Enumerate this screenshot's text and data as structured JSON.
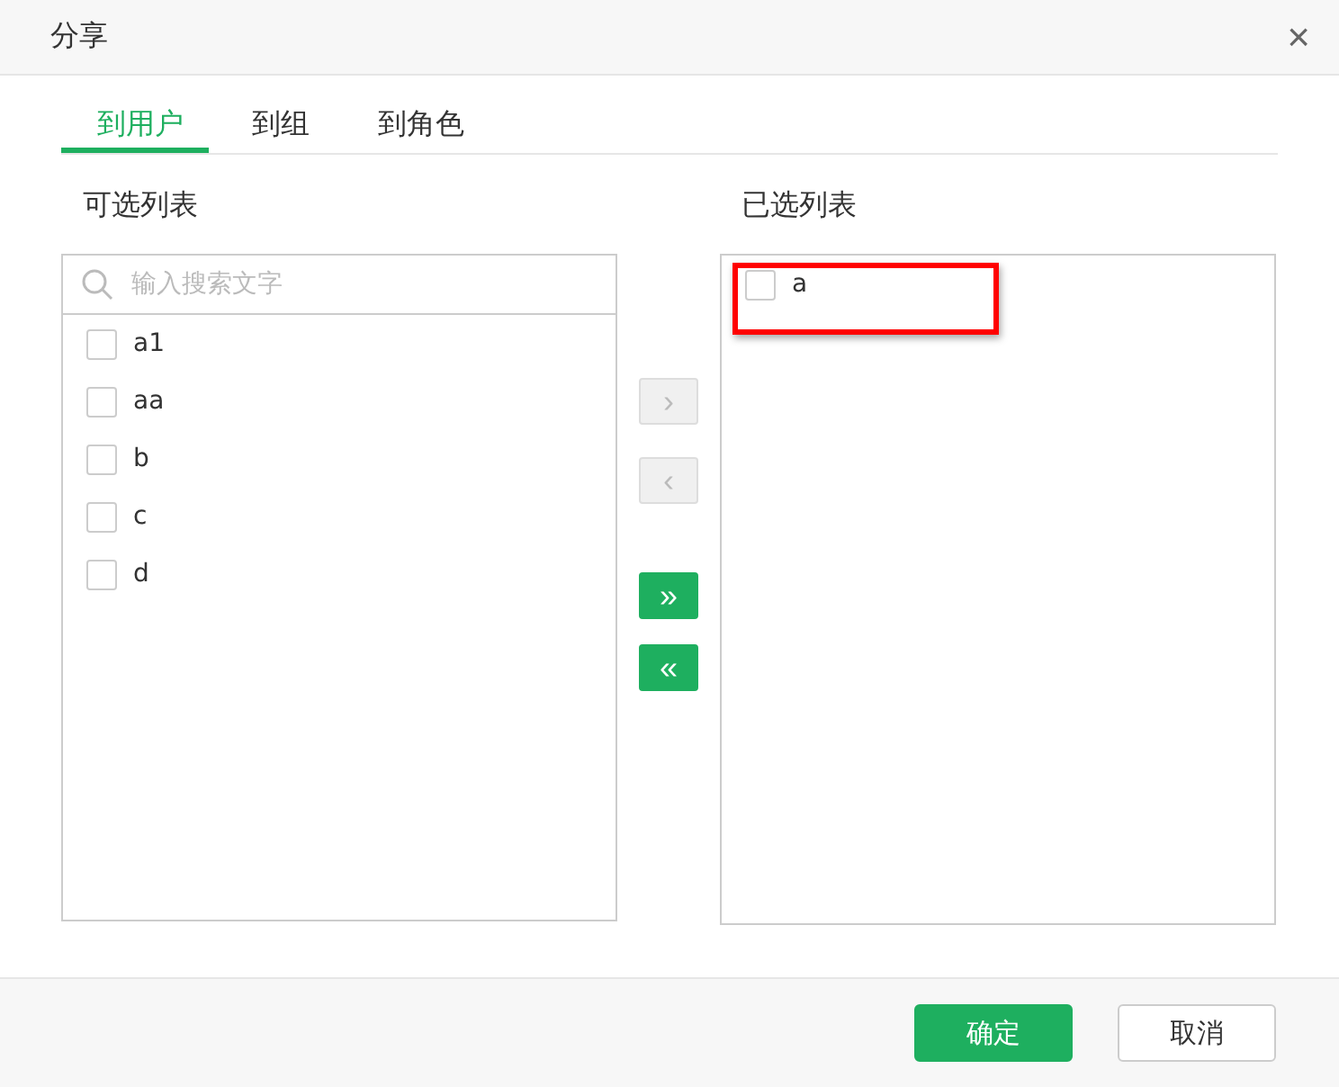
{
  "dialog": {
    "title": "分享",
    "close": "×"
  },
  "tabs": [
    {
      "label": "到用户",
      "selected": true
    },
    {
      "label": "到组",
      "selected": false
    },
    {
      "label": "到角色",
      "selected": false
    }
  ],
  "available": {
    "title": "可选列表",
    "search": {
      "placeholder": "输入搜索文字"
    },
    "items": [
      {
        "label": "a1",
        "checked": false
      },
      {
        "label": "aa",
        "checked": false
      },
      {
        "label": "b",
        "checked": false
      },
      {
        "label": "c",
        "checked": false
      },
      {
        "label": "d",
        "checked": false
      }
    ]
  },
  "transfer_buttons": [
    {
      "label": "›",
      "disabled": true
    },
    {
      "label": "‹",
      "disabled": true
    },
    {
      "label": "»",
      "disabled": false
    },
    {
      "label": "«",
      "disabled": false
    }
  ],
  "selected_list": {
    "title": "已选列表",
    "items": [
      {
        "label": "a",
        "checked": false,
        "highlighted": true
      }
    ]
  },
  "footer": {
    "buttons": [
      {
        "label": "确定",
        "kind": "primary"
      },
      {
        "label": "取消",
        "kind": "secondary"
      }
    ]
  }
}
